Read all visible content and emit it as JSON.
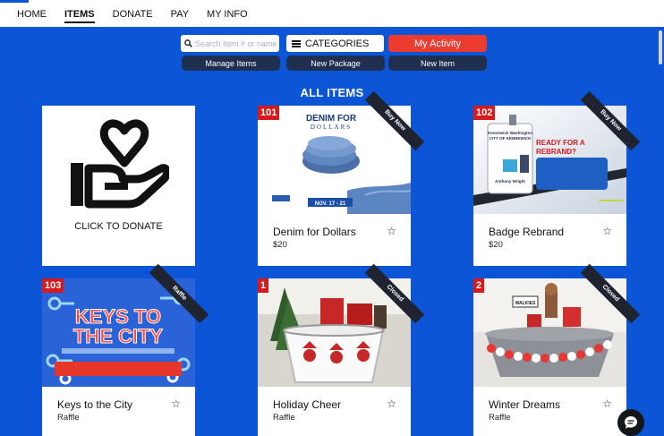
{
  "nav": {
    "items": [
      {
        "label": "HOME",
        "active": false
      },
      {
        "label": "ITEMS",
        "active": true
      },
      {
        "label": "DONATE",
        "active": false
      },
      {
        "label": "PAY",
        "active": false
      },
      {
        "label": "MY INFO",
        "active": false
      }
    ]
  },
  "toolbar": {
    "search_placeholder": "Search Item # or name",
    "categories_label": "CATEGORIES",
    "my_activity_label": "My Activity",
    "manage_items_label": "Manage Items",
    "new_package_label": "New Package",
    "new_item_label": "New Item"
  },
  "heading": "ALL ITEMS",
  "donate_card": {
    "label": "CLICK TO DONATE"
  },
  "items": [
    {
      "number": "101",
      "title": "Denim for Dollars",
      "subtitle": "$20",
      "status": "Buy Now",
      "image_text": {
        "line1": "DENIM FOR",
        "line2": "DOLLARS",
        "dates": "NOV. 17 - 21"
      }
    },
    {
      "number": "102",
      "title": "Badge Rebrand",
      "subtitle": "$20",
      "status": "Buy Now",
      "image_text": {
        "line1": "READY FOR A",
        "line2": "REBRAND?",
        "city1": "Kennewick Washington",
        "city2": "CITY OF KENNEWICK",
        "person": "Anthony Wright"
      }
    },
    {
      "number": "103",
      "title": "Keys to the City",
      "subtitle": "Raffle",
      "status": "Raffle",
      "image_text": {
        "line1": "KEYS TO",
        "line2": "THE CITY"
      }
    },
    {
      "number": "1",
      "title": "Holiday Cheer",
      "subtitle": "Raffle",
      "status": "Closed"
    },
    {
      "number": "2",
      "title": "Winter Dreams",
      "subtitle": "Raffle",
      "status": "Closed",
      "image_text": {
        "sign": "WALKIES"
      }
    }
  ],
  "colors": {
    "brand_blue": "#0b55d6",
    "accent_red": "#ee3b2f",
    "dark_button": "#1f2f4f",
    "badge_red": "#d7191c"
  }
}
